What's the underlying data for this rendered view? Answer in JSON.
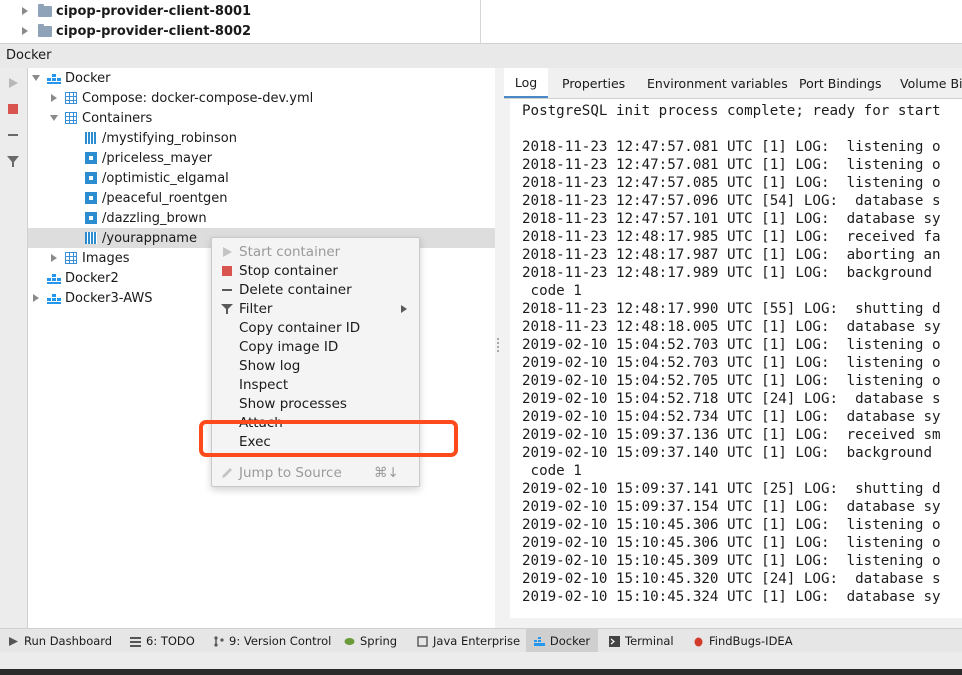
{
  "project_tree": [
    {
      "label": "cipop-provider-client-8001"
    },
    {
      "label": "cipop-provider-client-8002"
    }
  ],
  "tool_window": {
    "title": "Docker"
  },
  "docker_tree": {
    "root": "Docker",
    "compose": "Compose: docker-compose-dev.yml",
    "containers_label": "Containers",
    "containers": [
      {
        "name": "/mystifying_robinson",
        "state": "running"
      },
      {
        "name": "/priceless_mayer",
        "state": "stopped"
      },
      {
        "name": "/optimistic_elgamal",
        "state": "stopped"
      },
      {
        "name": "/peaceful_roentgen",
        "state": "stopped"
      },
      {
        "name": "/dazzling_brown",
        "state": "stopped"
      },
      {
        "name": "/yourappname",
        "state": "running"
      }
    ],
    "images_label": "Images",
    "other_roots": [
      "Docker2",
      "Docker3-AWS"
    ]
  },
  "tabs": [
    "Log",
    "Properties",
    "Environment variables",
    "Port Bindings",
    "Volume Bin"
  ],
  "active_tab": "Log",
  "log_lines": [
    "PostgreSQL init process complete; ready for start",
    "",
    "2018-11-23 12:47:57.081 UTC [1] LOG:  listening o",
    "2018-11-23 12:47:57.081 UTC [1] LOG:  listening o",
    "2018-11-23 12:47:57.085 UTC [1] LOG:  listening o",
    "2018-11-23 12:47:57.096 UTC [54] LOG:  database s",
    "2018-11-23 12:47:57.101 UTC [1] LOG:  database sy",
    "2018-11-23 12:48:17.985 UTC [1] LOG:  received fa",
    "2018-11-23 12:48:17.987 UTC [1] LOG:  aborting an",
    "2018-11-23 12:48:17.989 UTC [1] LOG:  background ",
    " code 1",
    "2018-11-23 12:48:17.990 UTC [55] LOG:  shutting d",
    "2018-11-23 12:48:18.005 UTC [1] LOG:  database sy",
    "2019-02-10 15:04:52.703 UTC [1] LOG:  listening o",
    "2019-02-10 15:04:52.703 UTC [1] LOG:  listening o",
    "2019-02-10 15:04:52.705 UTC [1] LOG:  listening o",
    "2019-02-10 15:04:52.718 UTC [24] LOG:  database s",
    "2019-02-10 15:04:52.734 UTC [1] LOG:  database sy",
    "2019-02-10 15:09:37.136 UTC [1] LOG:  received sm",
    "2019-02-10 15:09:37.140 UTC [1] LOG:  background ",
    " code 1",
    "2019-02-10 15:09:37.141 UTC [25] LOG:  shutting d",
    "2019-02-10 15:09:37.154 UTC [1] LOG:  database sy",
    "2019-02-10 15:10:45.306 UTC [1] LOG:  listening o",
    "2019-02-10 15:10:45.306 UTC [1] LOG:  listening o",
    "2019-02-10 15:10:45.309 UTC [1] LOG:  listening o",
    "2019-02-10 15:10:45.320 UTC [24] LOG:  database s",
    "2019-02-10 15:10:45.324 UTC [1] LOG:  database sy"
  ],
  "context_menu": {
    "items": [
      {
        "label": "Start container",
        "icon": "play-icon",
        "disabled": true
      },
      {
        "label": "Stop container",
        "icon": "stop-icon",
        "disabled": false
      },
      {
        "label": "Delete container",
        "icon": "minus-icon",
        "disabled": false
      },
      {
        "label": "Filter",
        "icon": "filter-icon",
        "disabled": false,
        "submenu": true
      },
      {
        "label": "Copy container ID",
        "disabled": false
      },
      {
        "label": "Copy image ID",
        "disabled": false
      },
      {
        "label": "Show log",
        "disabled": false
      },
      {
        "label": "Inspect",
        "disabled": false
      },
      {
        "label": "Show processes",
        "disabled": false
      },
      {
        "label": "Attach",
        "disabled": false
      },
      {
        "label": "Exec",
        "disabled": false
      },
      {
        "label": "Jump to Source",
        "icon": "pencil-icon",
        "disabled": true,
        "shortcut": "⌘↓"
      }
    ],
    "highlight_color": "#ff4a1c"
  },
  "bottom_tools": [
    {
      "label": "Run Dashboard",
      "icon": "run-dashboard-icon"
    },
    {
      "label": "6: TODO",
      "icon": "todo-icon"
    },
    {
      "label": "9: Version Control",
      "icon": "version-control-icon"
    },
    {
      "label": "Spring",
      "icon": "spring-icon"
    },
    {
      "label": "Java Enterprise",
      "icon": "java-enterprise-icon"
    },
    {
      "label": "Docker",
      "icon": "docker-icon",
      "active": true
    },
    {
      "label": "Terminal",
      "icon": "terminal-icon"
    },
    {
      "label": "FindBugs-IDEA",
      "icon": "findbugs-icon"
    }
  ],
  "colors": {
    "docker_blue": "#2396ed",
    "container_blue": "#2b8ccf",
    "stop_red": "#d9534f",
    "tab_underline": "#4a88c7"
  }
}
